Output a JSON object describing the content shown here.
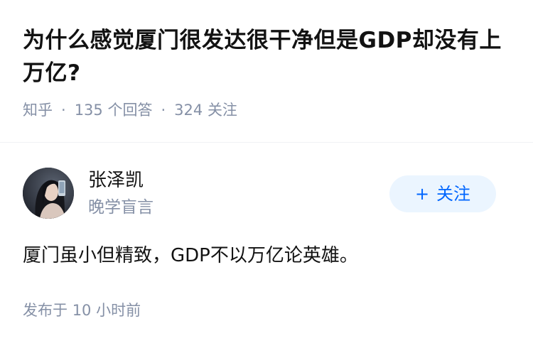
{
  "question": {
    "title": "为什么感觉厦门很发达很干净但是GDP却没有上万亿?",
    "source": "知乎",
    "separator": "·",
    "answer_count": "135",
    "answer_count_label": "个回答",
    "follower_count": "324",
    "follower_count_label": "关注"
  },
  "answer": {
    "author": {
      "name": "张泽凯",
      "bio": "晚学盲言",
      "avatar_icon": "user-avatar-photo"
    },
    "follow_button": {
      "icon": "plus-icon",
      "plus_symbol": "+",
      "label": "关注"
    },
    "content": "厦门虽小但精致，GDP不以万亿论英雄。",
    "published_label": "发布于",
    "published_time": "10 小时前"
  },
  "colors": {
    "text_primary": "#121212",
    "text_secondary": "#8590a6",
    "follow_button_bg": "#ebf5ff",
    "follow_button_text": "#0066ff",
    "divider": "#f0f2f5"
  }
}
